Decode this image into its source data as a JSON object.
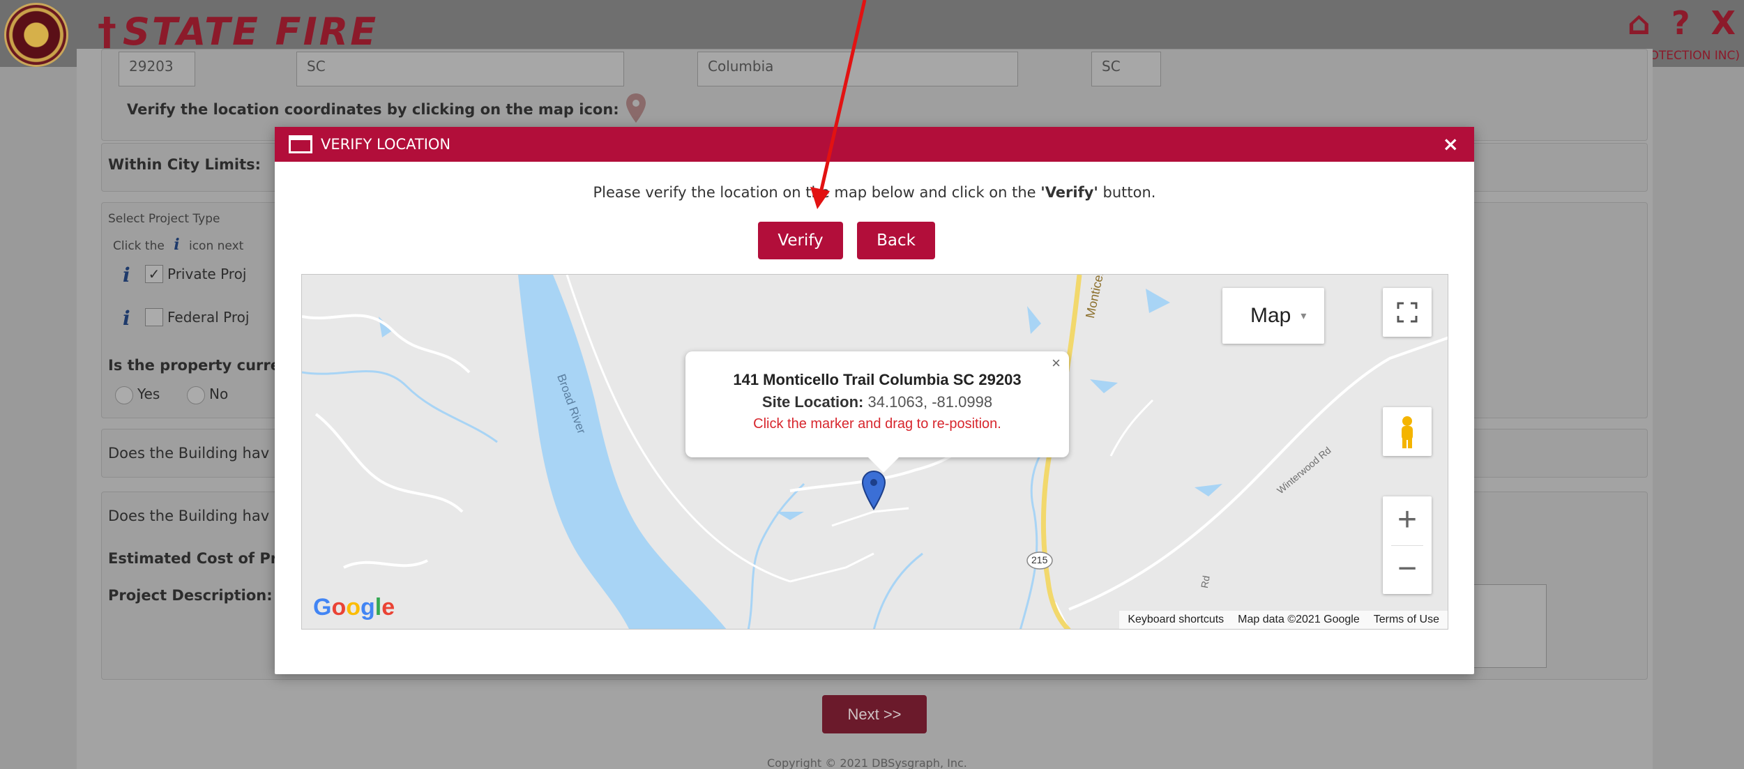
{
  "header": {
    "brand_title": "STATE FIRE",
    "welcome_text": "Welcome, STUART (Selected Entity: AMERICAN FIRE PROTECTION INC)",
    "home_icon": "home-icon",
    "help_label": "?",
    "exit_label": "X"
  },
  "background_form": {
    "zip_value": "29203",
    "state_value": "SC",
    "city_value": "Columbia",
    "state_select": "SC",
    "verify_coords_label": "Verify the location coordinates by clicking on the map icon:",
    "within_city_limits_label": "Within City Limits:",
    "select_project_type_label": "Select Project Type",
    "click_icon_hint": "Click the",
    "icon_next_label": "icon next",
    "private_project_label": "Private Proj",
    "federal_project_label": "Federal Proj",
    "private_checked_mark": "✓",
    "property_question": "Is the property curre",
    "yes_label": "Yes",
    "no_label": "No",
    "building_question_1": "Does the Building hav",
    "building_question_2": "Does the Building hav",
    "estimated_cost_label": "Estimated Cost of Pr",
    "project_description_label": "Project Description:",
    "next_button": "Next >>",
    "copyright": "Copyright © 2021 DBSysgraph, Inc."
  },
  "modal": {
    "title": "VERIFY LOCATION",
    "close_label": "×",
    "instruction_before": "Please verify the location on the map below and click on the ",
    "instruction_bold": "'Verify'",
    "instruction_after": " button.",
    "verify_button": "Verify",
    "back_button": "Back"
  },
  "map": {
    "map_type_label": "Map",
    "infowindow": {
      "address": "141 Monticello Trail Columbia SC 29203",
      "site_location_label": "Site Location:",
      "site_location_value": "34.1063, -81.0998",
      "note": "Click the marker and drag to re-position.",
      "close_label": "×"
    },
    "labels": {
      "river": "Broad River",
      "monticello_rd": "Monticello Rd",
      "winterwood_rd": "Winterwood Rd",
      "route": "215",
      "rd_fragment": "Rd"
    },
    "google_logo": "Google",
    "footer": {
      "keyboard_shortcuts": "Keyboard shortcuts",
      "map_data": "Map data ©2021 Google",
      "terms": "Terms of Use"
    },
    "colors": {
      "water": "#a8d4f5",
      "land": "#e8e8e8",
      "road_major": "#f2d86c",
      "marker": "#3b6fd6"
    }
  },
  "theme": {
    "accent": "#b20e3a",
    "brand_dark": "#8c1a2a"
  }
}
